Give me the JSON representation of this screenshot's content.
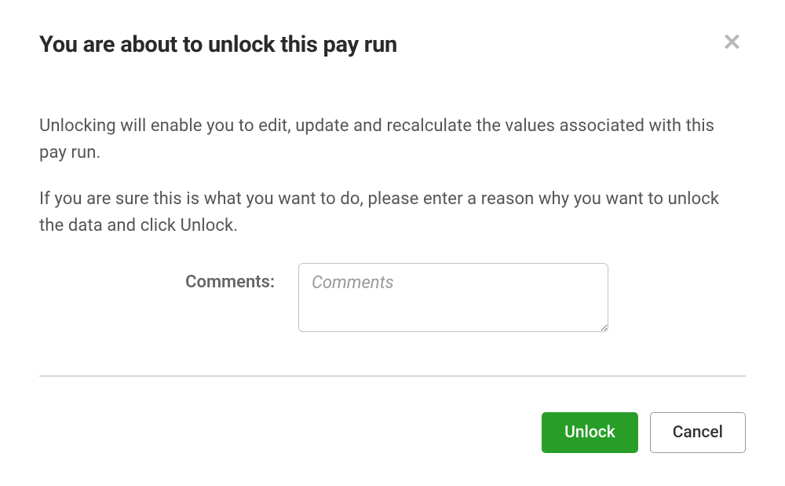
{
  "modal": {
    "title": "You are about to unlock this pay run",
    "body": {
      "paragraph1": "Unlocking will enable you to edit, update and recalculate the values associated with this pay run.",
      "paragraph2": "If you are sure this is what you want to do, please enter a reason why you want to unlock the data and click Unlock."
    },
    "form": {
      "comments_label": "Comments:",
      "comments_placeholder": "Comments",
      "comments_value": ""
    },
    "actions": {
      "primary_label": "Unlock",
      "secondary_label": "Cancel"
    }
  }
}
